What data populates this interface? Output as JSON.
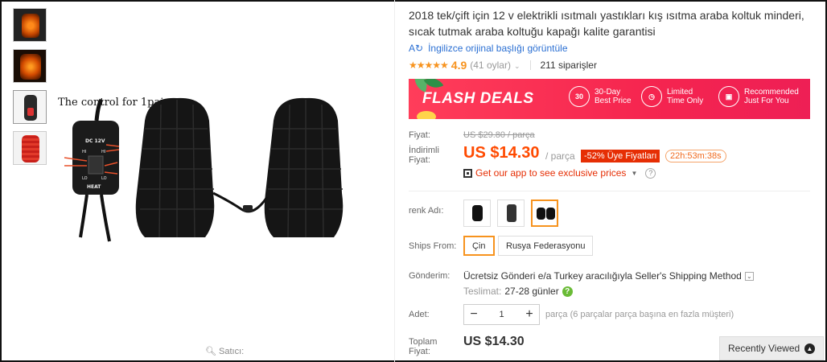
{
  "gallery": {
    "thumbnails": [
      "thumb-1",
      "thumb-2",
      "thumb-3",
      "thumb-4"
    ],
    "image_caption": "The control for 1pair",
    "controller_labels": [
      "DC 12V",
      "HI",
      "HI",
      "LO",
      "LO",
      "HEAT"
    ],
    "seller_label": "Satıcı:"
  },
  "product": {
    "title": "2018 tek/çift için 12 v elektrikli ısıtmalı yastıkları kış ısıtma araba koltuk minderi, sıcak tutmak araba koltuğu kapağı kalite garantisi",
    "translate_link": "İngilizce orijinal başlığı görüntüle",
    "rating_stars": "★★★★★",
    "rating_score": "4.9",
    "votes": "(41 oylar)",
    "orders": "211 siparişler"
  },
  "flash": {
    "title": "FLASH DEALS",
    "items": [
      {
        "icon": "30",
        "label": "30-Day\nBest Price"
      },
      {
        "icon": "clock",
        "label": "Limited\nTime Only"
      },
      {
        "icon": "gift",
        "label": "Recommended\nJust For You"
      }
    ]
  },
  "price": {
    "price_label": "Fiyat:",
    "old_price": "US $29.80 / parça",
    "discount_label": "İndirimli Fiyat:",
    "new_price": "US $14.30",
    "per_unit": "/ parça",
    "badge": "-52% Üye Fiyatları",
    "timer": "22h:53m:38s",
    "app_promo": "Get our app to see exclusive prices"
  },
  "options": {
    "color_label": "renk Adı:",
    "colors": [
      "seat-black",
      "seat-grey",
      "pair-black"
    ],
    "selected_color": 2,
    "ships_from_label": "Ships From:",
    "ships_from": [
      "Çin",
      "Rusya Federasyonu"
    ],
    "selected_ship": 0
  },
  "delivery": {
    "label": "Gönderim:",
    "text": "Ücretsiz Gönderi e/a Turkey aracılığıyla Seller's Shipping Method",
    "estimate_label": "Teslimat:",
    "estimate_days": "27-28 günler"
  },
  "quantity": {
    "label": "Adet:",
    "minus": "−",
    "value": "1",
    "plus": "+",
    "note": "parça (6 parçalar parça başına en fazla müşteri)"
  },
  "total": {
    "label": "Toplam Fiyat:",
    "value": "US $14.30"
  },
  "recently_viewed": "Recently Viewed",
  "colors": {
    "accent": "#ff4a00",
    "flash": "#f5254f",
    "selected_border": "#f7931e",
    "link": "#2a6fd3"
  }
}
